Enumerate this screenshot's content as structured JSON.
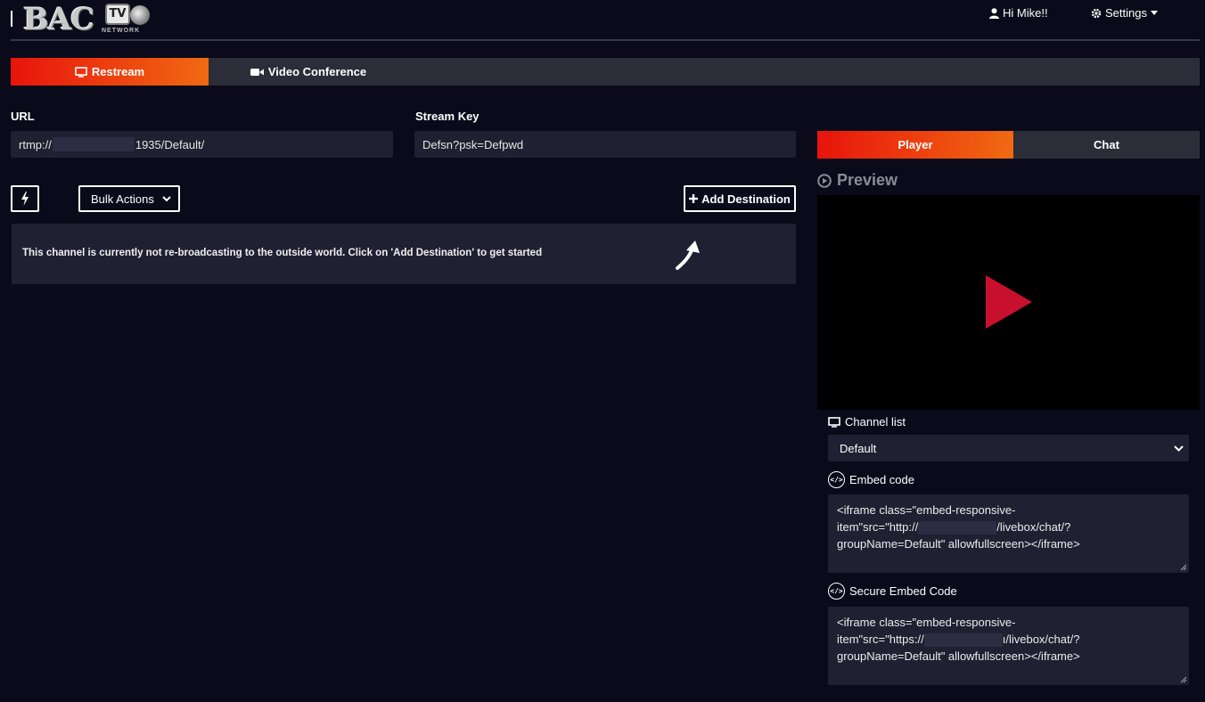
{
  "header": {
    "logo_text": "BAC",
    "logo_tv": "TV",
    "logo_network": "NETWORK",
    "greeting": "Hi Mike!!",
    "settings_label": "Settings"
  },
  "main_tabs": [
    {
      "label": "Restream",
      "icon": "monitor-icon",
      "active": true
    },
    {
      "label": "Video Conference",
      "icon": "video-camera-icon",
      "active": false
    }
  ],
  "url": {
    "label": "URL",
    "value_prefix": "rtmp://",
    "value_suffix": "1935/Default/"
  },
  "stream_key": {
    "label": "Stream Key",
    "value": "Defsn?psk=Defpwd"
  },
  "actions": {
    "bulk_actions_label": "Bulk Actions",
    "add_destination_label": "Add Destination"
  },
  "empty_state": {
    "text_before": "This channel is currently not re-broadcasting to the outside world. Click on ",
    "text_bold": "'Add Destination'",
    "text_after": " to get started"
  },
  "right_tabs": [
    {
      "label": "Player",
      "active": true
    },
    {
      "label": "Chat",
      "active": false
    }
  ],
  "preview": {
    "heading": "Preview"
  },
  "channel_list": {
    "label": "Channel list",
    "selected": "Default"
  },
  "embed_code": {
    "label": "Embed code",
    "line1": "<iframe class=\"embed-responsive-",
    "line2_prefix": "item\"src=\"http://",
    "line2_suffix": "/livebox/chat/?",
    "line3": "groupName=Default\" allowfullscreen></iframe>"
  },
  "secure_embed_code": {
    "label": "Secure Embed Code",
    "line1": "<iframe class=\"embed-responsive-",
    "line2_prefix": "item\"src=\"https://",
    "line2_suffix": "ı/livebox/chat/?",
    "line3": "groupName=Default\" allowfullscreen></iframe>"
  },
  "colors": {
    "background": "#0b0a1a",
    "panel": "#202033",
    "tab_inactive": "#2b2e38",
    "accent_start": "#e8140c",
    "accent_end": "#f06a12",
    "play_icon": "#c8102e"
  }
}
